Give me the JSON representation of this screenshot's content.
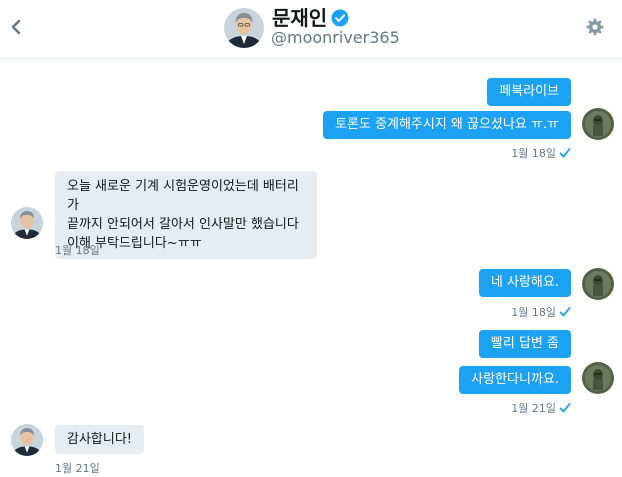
{
  "header": {
    "name": "문재인",
    "handle": "@moonriver365"
  },
  "messages": [
    {
      "text": "페북라이브"
    },
    {
      "text": "토론도 중계해주시지 왜 끊으셨나요 ㅠ.ㅠ"
    },
    {
      "text": "1월 18일"
    },
    {
      "line1": "오늘 새로운 기계 시험운영이었는데 배터리가",
      "line2": "끝까지 안되어서 갈아서 인사말만 했습니다",
      "line3": "이해 부탁드립니다~ㅠㅠ"
    },
    {
      "text": "1월 18일"
    },
    {
      "text": "네 사랑해요."
    },
    {
      "text": "1월 18일"
    },
    {
      "text": "빨리 답변 좀"
    },
    {
      "text": "사랑한다니까요."
    },
    {
      "text": "1월 21일"
    },
    {
      "text": "감사합니다!"
    },
    {
      "text": "1월 21일"
    }
  ],
  "colors": {
    "accent": "#1da1f2",
    "received_bubble": "#e6ecf0",
    "muted": "#657786"
  }
}
